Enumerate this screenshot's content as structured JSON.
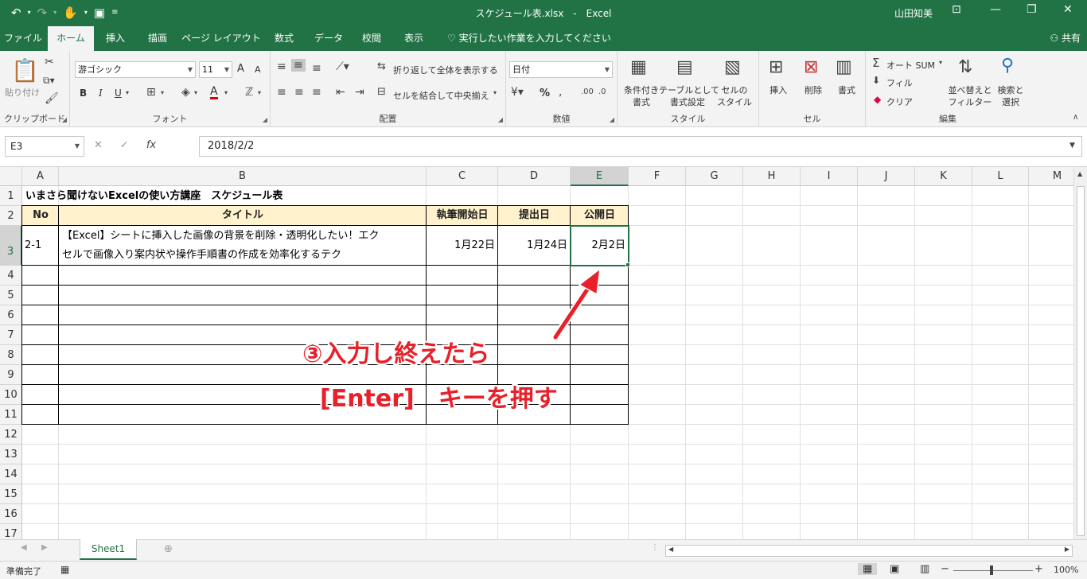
{
  "window": {
    "title": "スケジュール表.xlsx　-　Excel",
    "user": "山田知美"
  },
  "tabs": [
    {
      "label": "ファイル",
      "active": false
    },
    {
      "label": "ホーム",
      "active": true
    },
    {
      "label": "挿入",
      "active": false
    },
    {
      "label": "描画",
      "active": false
    },
    {
      "label": "ページ レイアウト",
      "active": false
    },
    {
      "label": "数式",
      "active": false
    },
    {
      "label": "データ",
      "active": false
    },
    {
      "label": "校閲",
      "active": false
    },
    {
      "label": "表示",
      "active": false
    }
  ],
  "tellme": "実行したい作業を入力してください",
  "share": "共有",
  "ribbon": {
    "clipboard": {
      "paste": "貼り付け",
      "label": "クリップボード"
    },
    "font": {
      "name": "游ゴシック",
      "size": "11",
      "bold": "B",
      "italic": "I",
      "underline": "U",
      "label": "フォント",
      "grow": "A",
      "shrink": "A",
      "color": "A"
    },
    "alignment": {
      "wrap": "折り返して全体を表示する",
      "merge": "セルを結合して中央揃え",
      "label": "配置"
    },
    "number": {
      "format": "日付",
      "percent": "%",
      "label": "数値"
    },
    "styles": {
      "conditional": "条件付き\n書式",
      "table": "テーブルとして\n書式設定",
      "cell": "セルの\nスタイル",
      "label": "スタイル"
    },
    "cells": {
      "insert": "挿入",
      "delete": "削除",
      "format": "書式",
      "label": "セル"
    },
    "editing": {
      "autosum": "オート SUM",
      "fill": "フィル",
      "clear": "クリア",
      "sort": "並べ替えと\nフィルター",
      "find": "検索と\n選択",
      "label": "編集"
    }
  },
  "formula_bar": {
    "name_box": "E3",
    "formula": "2018/2/2"
  },
  "sheet": {
    "columns": [
      "A",
      "B",
      "C",
      "D",
      "E",
      "F",
      "G",
      "H",
      "I",
      "J",
      "K",
      "L",
      "M"
    ],
    "rows": [
      "1",
      "2",
      "3",
      "4",
      "5",
      "6",
      "7",
      "8",
      "9",
      "10",
      "11",
      "12",
      "13",
      "14",
      "15",
      "16",
      "17"
    ],
    "title": "いまさら聞けないExcelの使い方講座　スケジュール表",
    "headers": {
      "no": "No",
      "title": "タイトル",
      "start": "執筆開始日",
      "submit": "提出日",
      "publish": "公開日"
    },
    "row3": {
      "no": "2-1",
      "title_line1": "【Excel】シートに挿入した画像の背景を削除・透明化したい！エク",
      "title_line2": "セルで画像入り案内状や操作手順書の作成を効率化するテク",
      "start": "1月22日",
      "submit": "1月24日",
      "publish": "2月2日"
    },
    "active_cell": "E3"
  },
  "annotation": {
    "line1": "③入力し終えたら",
    "line2": "[Enter]　キーを押す",
    "color": "#e8202a"
  },
  "sheet_tabs": [
    {
      "label": "Sheet1",
      "active": true
    }
  ],
  "status": {
    "ready": "準備完了",
    "zoom": "100%"
  },
  "colors": {
    "brand": "#217346",
    "header_fill": "#fff2cc"
  }
}
